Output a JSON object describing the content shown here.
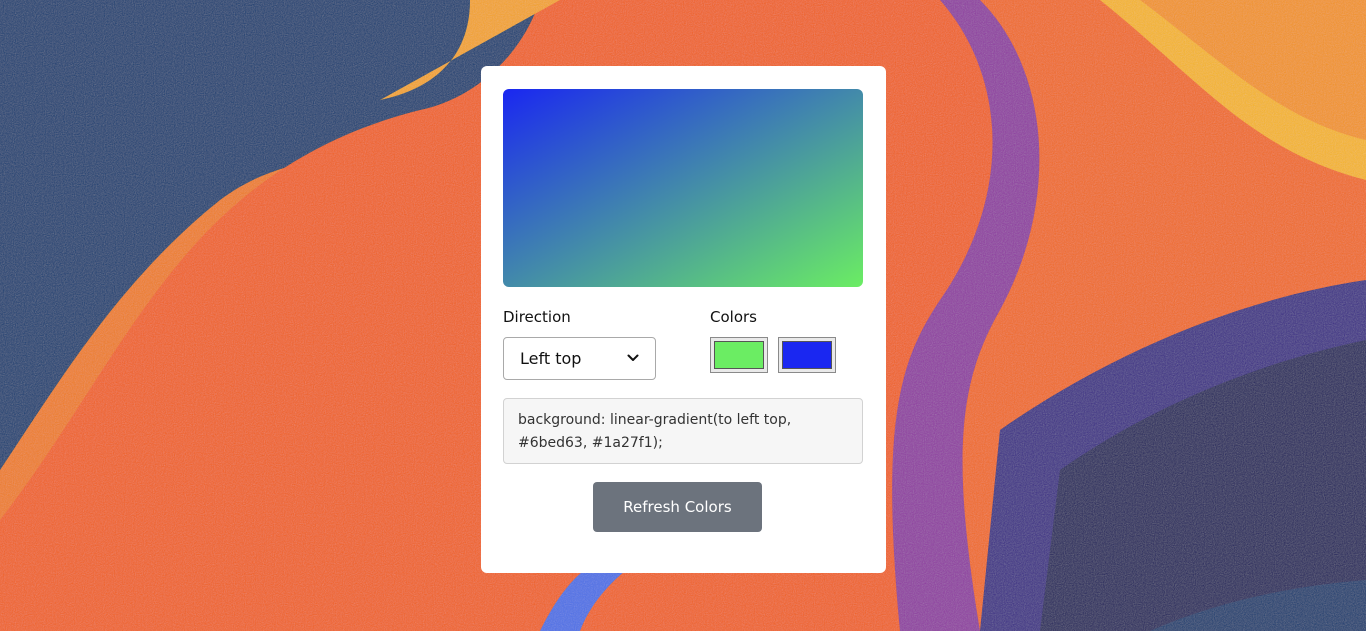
{
  "colors": {
    "color_one": "#6bed63",
    "color_two": "#1a27f1",
    "button_bg": "#6c737d"
  },
  "labels": {
    "direction": "Direction",
    "colors": "Colors"
  },
  "direction_select": {
    "value": "Left top",
    "icon": "chevron-down-icon"
  },
  "css_output": "background: linear-gradient(to left top, #6bed63, #1a27f1);",
  "buttons": {
    "refresh": "Refresh Colors"
  }
}
